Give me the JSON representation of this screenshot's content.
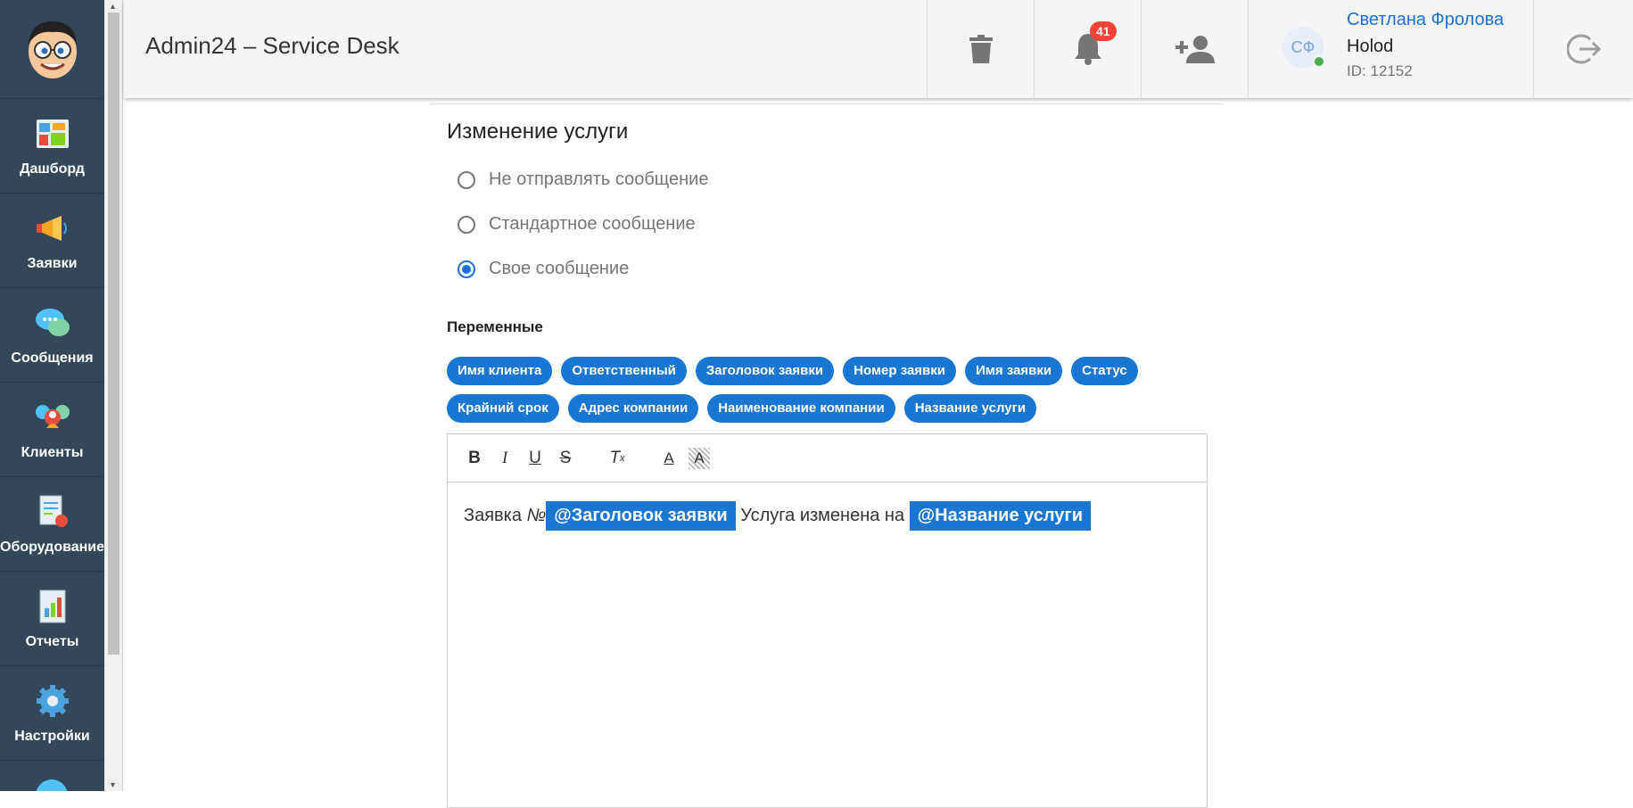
{
  "app": {
    "title": "Admin24 – Service Desk"
  },
  "sidebar": {
    "items": [
      {
        "label": "Дашборд",
        "icon": "dashboard-icon"
      },
      {
        "label": "Заявки",
        "icon": "megaphone-icon"
      },
      {
        "label": "Сообщения",
        "icon": "chat-icon"
      },
      {
        "label": "Клиенты",
        "icon": "clients-icon"
      },
      {
        "label": "Оборудование",
        "icon": "equipment-icon"
      },
      {
        "label": "Отчеты",
        "icon": "reports-icon"
      },
      {
        "label": "Настройки",
        "icon": "settings-icon"
      }
    ]
  },
  "header": {
    "notifications_count": "41",
    "user": {
      "initials": "СФ",
      "name": "Светлана Фролова",
      "company": "Holod",
      "id": "ID: 12152"
    }
  },
  "section": {
    "title": "Изменение услуги",
    "options": [
      {
        "label": "Не отправлять сообщение",
        "checked": false
      },
      {
        "label": "Стандартное сообщение",
        "checked": false
      },
      {
        "label": "Свое сообщение",
        "checked": true
      }
    ]
  },
  "variables": {
    "title": "Переменные",
    "chips": [
      "Имя клиента",
      "Ответственный",
      "Заголовок заявки",
      "Номер заявки",
      "Имя заявки",
      "Статус",
      "Крайний срок",
      "Адрес компании",
      "Наименование компании",
      "Название услуги"
    ]
  },
  "editor": {
    "text_before": "Заявка ",
    "text_italic": "№",
    "tag1": "@Заголовок заявки",
    "text_middle": " Услуга изменена на ",
    "tag2": "@Название услуги"
  },
  "colors": {
    "sidebar": "#33475b",
    "accent": "#1976d2",
    "badge": "#f44336",
    "link": "#1e6fd9"
  }
}
